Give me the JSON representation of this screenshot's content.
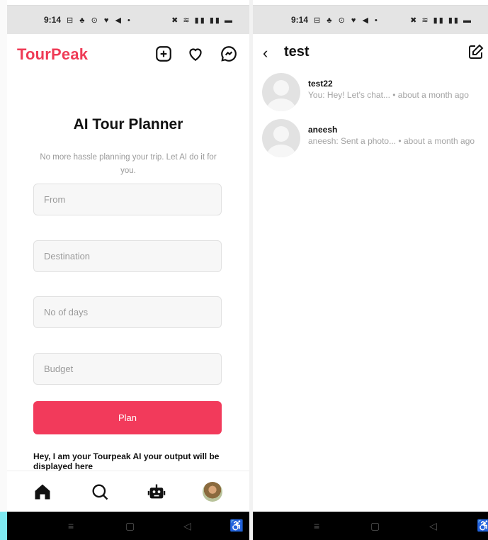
{
  "status_bar": {
    "time": "9:14",
    "left_glyphs": "⊟ ♣ ⊙ ♥ ◀ •",
    "right_glyphs": "✖ ≋ ▮▮ ▮▮ ▬"
  },
  "left_screen": {
    "brand": "TourPeak",
    "header_icons": [
      "add-square-icon",
      "heart-icon",
      "messenger-icon"
    ],
    "title": "AI Tour Planner",
    "subtitle": "No more hassle planning your trip. Let AI do it for you.",
    "fields": {
      "from_placeholder": "From",
      "destination_placeholder": "Destination",
      "days_placeholder": "No of days",
      "budget_placeholder": "Budget"
    },
    "plan_label": "Plan",
    "output_text": "Hey, I am your Tourpeak AI your output will be displayed here",
    "bottom_nav": [
      "home-icon",
      "search-icon",
      "robot-icon",
      "profile-avatar"
    ]
  },
  "right_screen": {
    "title": "test",
    "back_glyph": "‹",
    "conversations": [
      {
        "name": "test22",
        "preview": "You: Hey! Let's chat...  •  about a month ago"
      },
      {
        "name": "aneesh",
        "preview": "aneesh: Sent a photo...  •  about a month ago"
      }
    ]
  },
  "system_nav": {
    "menu": "≡",
    "home": "▢",
    "back": "◁",
    "accessibility": "♿"
  },
  "colors": {
    "brand": "#ef3b56",
    "button": "#f23a5b",
    "status_bar": "#e4e4e4"
  }
}
